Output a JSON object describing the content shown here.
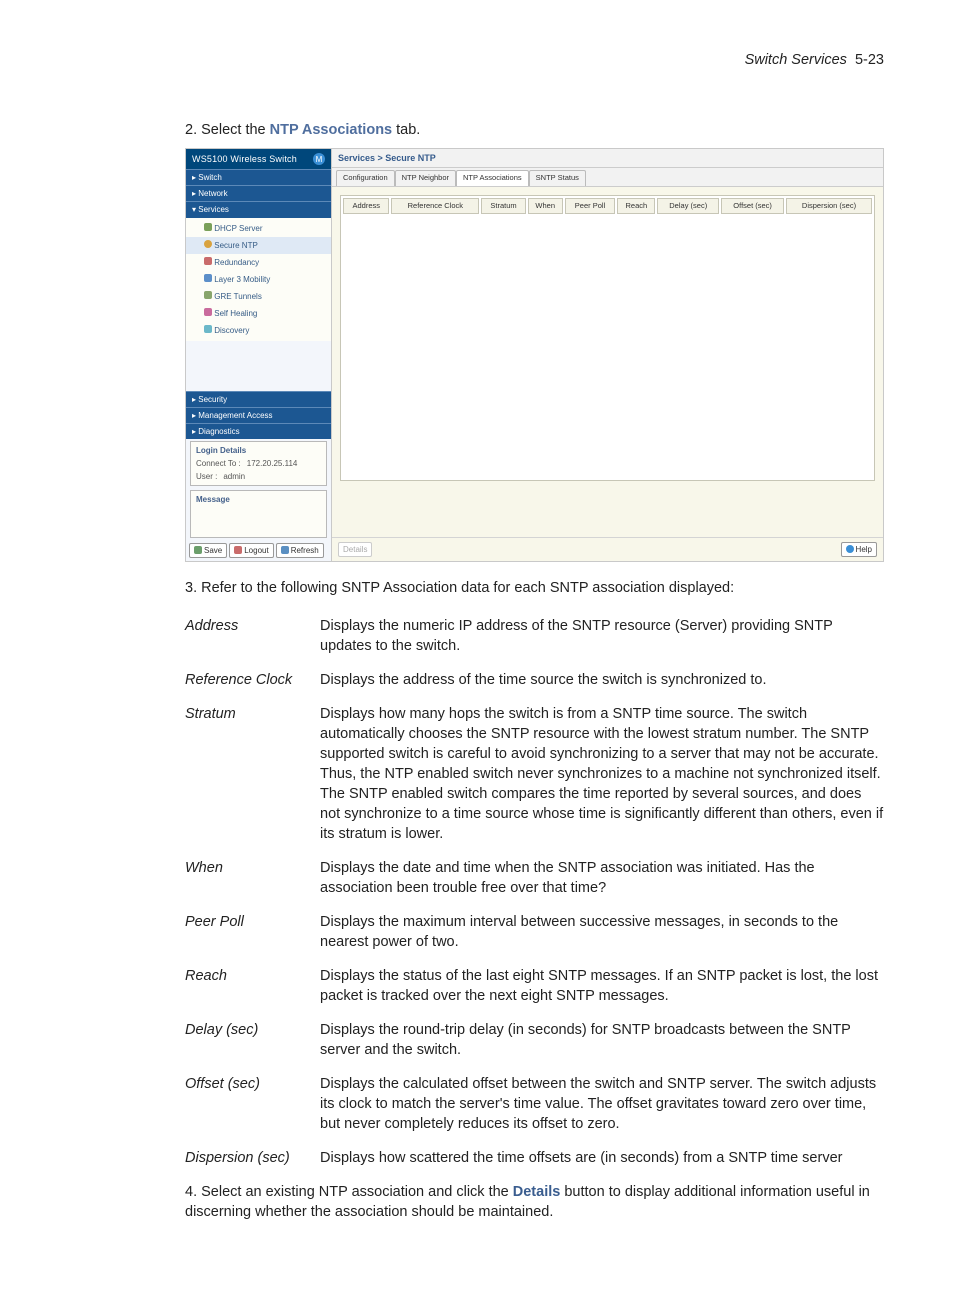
{
  "header": {
    "section_italic": "Switch Services",
    "page_no": "5-23"
  },
  "steps": {
    "s2_prefix": "2. Select the ",
    "s2_bold": "NTP Associations",
    "s2_suffix": " tab.",
    "s3": "3. Refer to the following SNTP Association data for each SNTP association displayed:",
    "s4_prefix": "4. Select an existing NTP association and click the ",
    "s4_bold": "Details",
    "s4_suffix": " button to display additional information useful in discerning whether the association should be maintained."
  },
  "shot": {
    "brand": "WS5100 Wireless Switch",
    "nav": {
      "switch": "Switch",
      "network": "Network",
      "services": "Services",
      "security": "Security",
      "management": "Management Access",
      "diagnostics": "Diagnostics"
    },
    "tree": {
      "dhcp": "DHCP Server",
      "secure_ntp": "Secure NTP",
      "redundancy": "Redundancy",
      "l3": "Layer 3 Mobility",
      "gre": "GRE Tunnels",
      "self_healing": "Self Healing",
      "discovery": "Discovery"
    },
    "login": {
      "title": "Login Details",
      "connect_label": "Connect To :",
      "connect_val": "172.20.25.114",
      "user_label": "User :",
      "user_val": "admin",
      "message": "Message"
    },
    "buttons": {
      "save": "Save",
      "logout": "Logout",
      "refresh": "Refresh",
      "details": "Details",
      "help": "Help"
    },
    "breadcrumb": "Services > Secure NTP",
    "tabs": {
      "config": "Configuration",
      "neighbor": "NTP Neighbor",
      "assoc": "NTP Associations",
      "status": "SNTP Status"
    },
    "columns": {
      "address": "Address",
      "ref_clock": "Reference Clock",
      "stratum": "Stratum",
      "when": "When",
      "peer_poll": "Peer Poll",
      "reach": "Reach",
      "delay": "Delay (sec)",
      "offset": "Offset (sec)",
      "dispersion": "Dispersion (sec)"
    }
  },
  "defs": {
    "address": {
      "term": "Address",
      "def": "Displays the numeric IP address of the SNTP resource (Server) providing SNTP updates to the switch."
    },
    "ref_clock": {
      "term": "Reference Clock",
      "def": "Displays the address of the time source the switch is synchronized to."
    },
    "stratum": {
      "term": "Stratum",
      "def": "Displays how many hops the switch is from a SNTP time source. The switch automatically chooses the SNTP resource with the lowest stratum number. The SNTP supported switch is careful to avoid synchronizing to a server that may not be accurate. Thus, the NTP enabled switch never synchronizes to a machine not synchronized itself. The SNTP enabled switch compares the time reported by several sources, and does not synchronize to a time source whose time is significantly different than others, even if its stratum is lower."
    },
    "when": {
      "term": "When",
      "def": "Displays the date and time when the SNTP association was initiated. Has the association been trouble free over that time?"
    },
    "peer_poll": {
      "term": "Peer Poll",
      "def": "Displays the maximum interval between successive messages, in seconds to the nearest power of two."
    },
    "reach": {
      "term": "Reach",
      "def": "Displays the status of the last eight SNTP messages. If an SNTP packet is lost, the lost packet is tracked over the next eight SNTP messages."
    },
    "delay": {
      "term": "Delay (sec)",
      "def": "Displays the round-trip delay (in seconds) for SNTP broadcasts between the SNTP server and the switch."
    },
    "offset": {
      "term": "Offset (sec)",
      "def": "Displays the calculated offset between the switch and SNTP server. The switch adjusts its clock to match the server's time value. The offset gravitates toward zero over time, but never completely reduces its offset to zero."
    },
    "dispersion": {
      "term": "Dispersion (sec)",
      "def": "Displays how scattered the time offsets are (in seconds) from a SNTP time server"
    }
  }
}
